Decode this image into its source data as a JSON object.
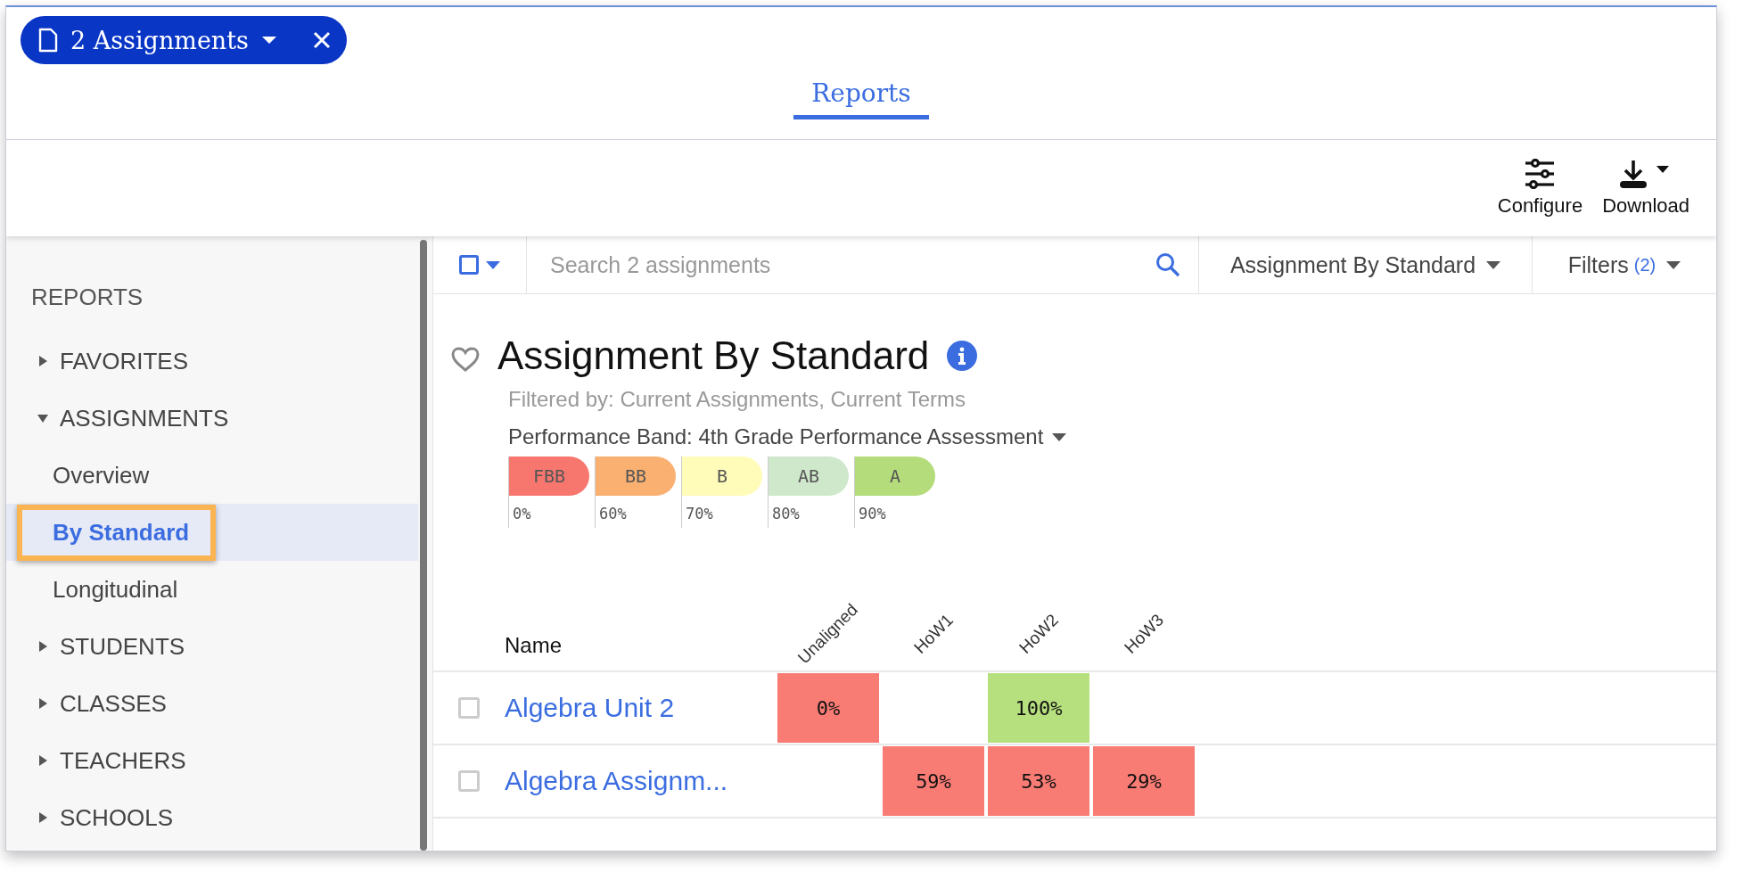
{
  "tab_chip": {
    "label": "2 Assignments"
  },
  "nav_tabs": [
    {
      "label": "Reports",
      "selected": true
    }
  ],
  "toolbar": [
    {
      "label": "Configure",
      "kind": "configure"
    },
    {
      "label": "Download",
      "kind": "download"
    }
  ],
  "sidebar": {
    "heading": "REPORTS",
    "items": [
      {
        "label": "FAVORITES",
        "expanded": false
      },
      {
        "label": "ASSIGNMENTS",
        "expanded": true,
        "children": [
          {
            "label": "Overview",
            "selected": false
          },
          {
            "label": "By Standard",
            "selected": true
          },
          {
            "label": "Longitudinal",
            "selected": false
          }
        ]
      },
      {
        "label": "STUDENTS",
        "expanded": false
      },
      {
        "label": "CLASSES",
        "expanded": false
      },
      {
        "label": "TEACHERS",
        "expanded": false
      },
      {
        "label": "SCHOOLS",
        "expanded": false
      }
    ]
  },
  "select_all": {
    "checked": false
  },
  "search": {
    "placeholder": "Search 2 assignments"
  },
  "view_select": {
    "value": "Assignment By Standard"
  },
  "filters": {
    "label": "Filters",
    "count": "(2)"
  },
  "report": {
    "title": "Assignment By Standard",
    "favorite": false,
    "filtered_by": "Filtered by: Current Assignments, Current Terms",
    "band_select": "Performance Band: 4th Grade Performance Assessment",
    "bands": [
      {
        "label": "FBB",
        "threshold": "0%",
        "color": "#f7776f"
      },
      {
        "label": "BB",
        "threshold": "60%",
        "color": "#f9b070"
      },
      {
        "label": "B",
        "threshold": "70%",
        "color": "#fefcb8"
      },
      {
        "label": "AB",
        "threshold": "80%",
        "color": "#cfe8cb"
      },
      {
        "label": "A",
        "threshold": "90%",
        "color": "#b4dc7a"
      }
    ]
  },
  "table": {
    "columns": [
      "Name",
      "Unaligned",
      "HoW1",
      "HoW2",
      "HoW3"
    ],
    "rows": [
      {
        "checked": false,
        "cells": [
          {
            "value": "Algebra Unit 2"
          },
          {
            "value": "0%",
            "color": "#f87b74"
          },
          null,
          {
            "value": "100%",
            "color": "#b6df7e"
          },
          null
        ]
      },
      {
        "checked": false,
        "cells": [
          {
            "value": "Algebra Assignm..."
          },
          null,
          {
            "value": "59%",
            "color": "#f87b74"
          },
          {
            "value": "53%",
            "color": "#f87b74"
          },
          {
            "value": "29%",
            "color": "#f87b74"
          }
        ]
      }
    ]
  }
}
